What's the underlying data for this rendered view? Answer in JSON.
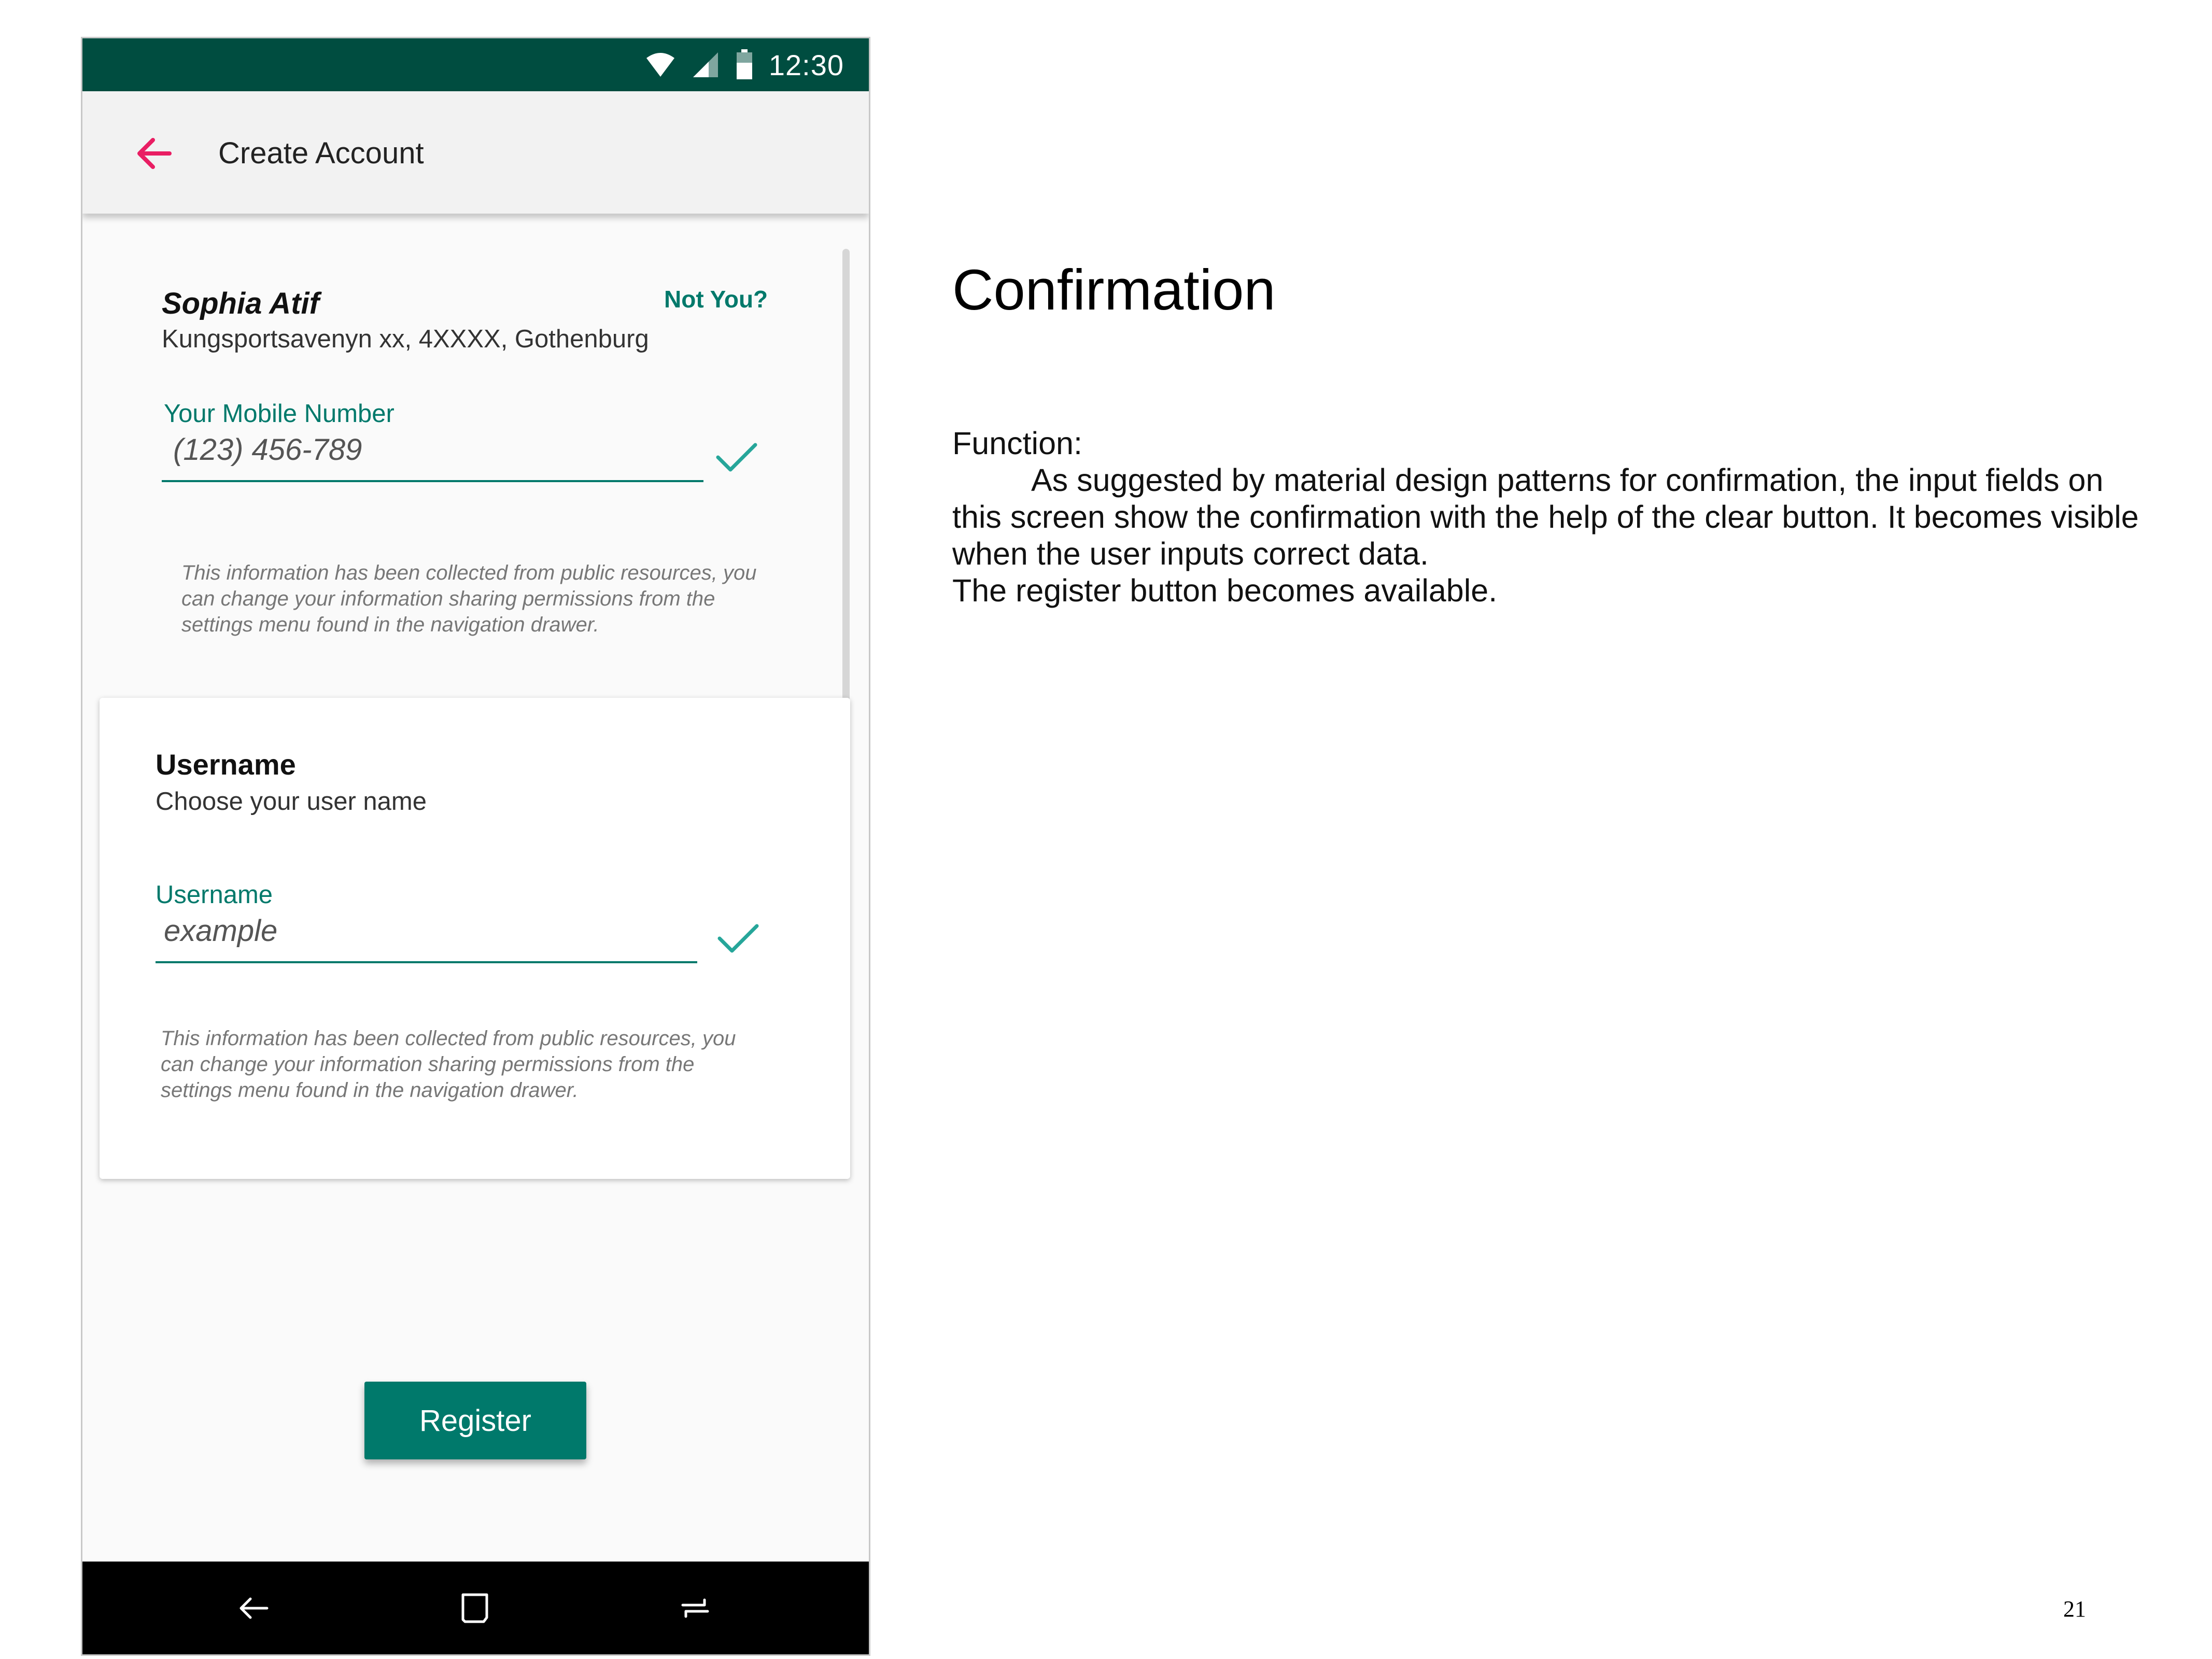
{
  "status_bar": {
    "time": "12:30",
    "icons": [
      "wifi-icon",
      "signal-icon",
      "battery-icon"
    ],
    "background_color": "#004d40"
  },
  "app_bar": {
    "title": "Create Account",
    "back_icon": "arrow-back-icon",
    "back_icon_color": "#e91e63"
  },
  "profile": {
    "name": "Sophia Atif",
    "address": "Kungsportsavenyn xx,  4XXXX, Gothenburg",
    "not_you_label": "Not You?"
  },
  "mobile_field": {
    "label": "Your Mobile Number",
    "value": "(123) 456-789",
    "status_icon": "check-icon",
    "hint": "This information has been collected from public resources, you can change your information sharing permissions from the settings menu found in the navigation drawer."
  },
  "username_card": {
    "heading": "Username",
    "subheading": "Choose your user name",
    "field_label": "Username",
    "value": "example",
    "status_icon": "check-icon",
    "hint": "This information has been collected from public resources, you can change your information sharing permissions from the settings menu found in the navigation drawer."
  },
  "register_button": {
    "label": "Register"
  },
  "nav_bar": {
    "icons": [
      "nav-back-icon",
      "nav-home-icon",
      "nav-recents-icon"
    ]
  },
  "colors": {
    "accent": "#00796b",
    "dark_teal": "#004d40",
    "pink": "#e91e63"
  },
  "document": {
    "title": "Confirmation",
    "function_label": "Function:",
    "paragraph": "As suggested by material design patterns for confirmation, the input fields on this screen show the confirmation with the help of the clear button. It becomes visible when the user inputs correct data.",
    "paragraph2": "The register button becomes available.",
    "page_number": "21"
  }
}
